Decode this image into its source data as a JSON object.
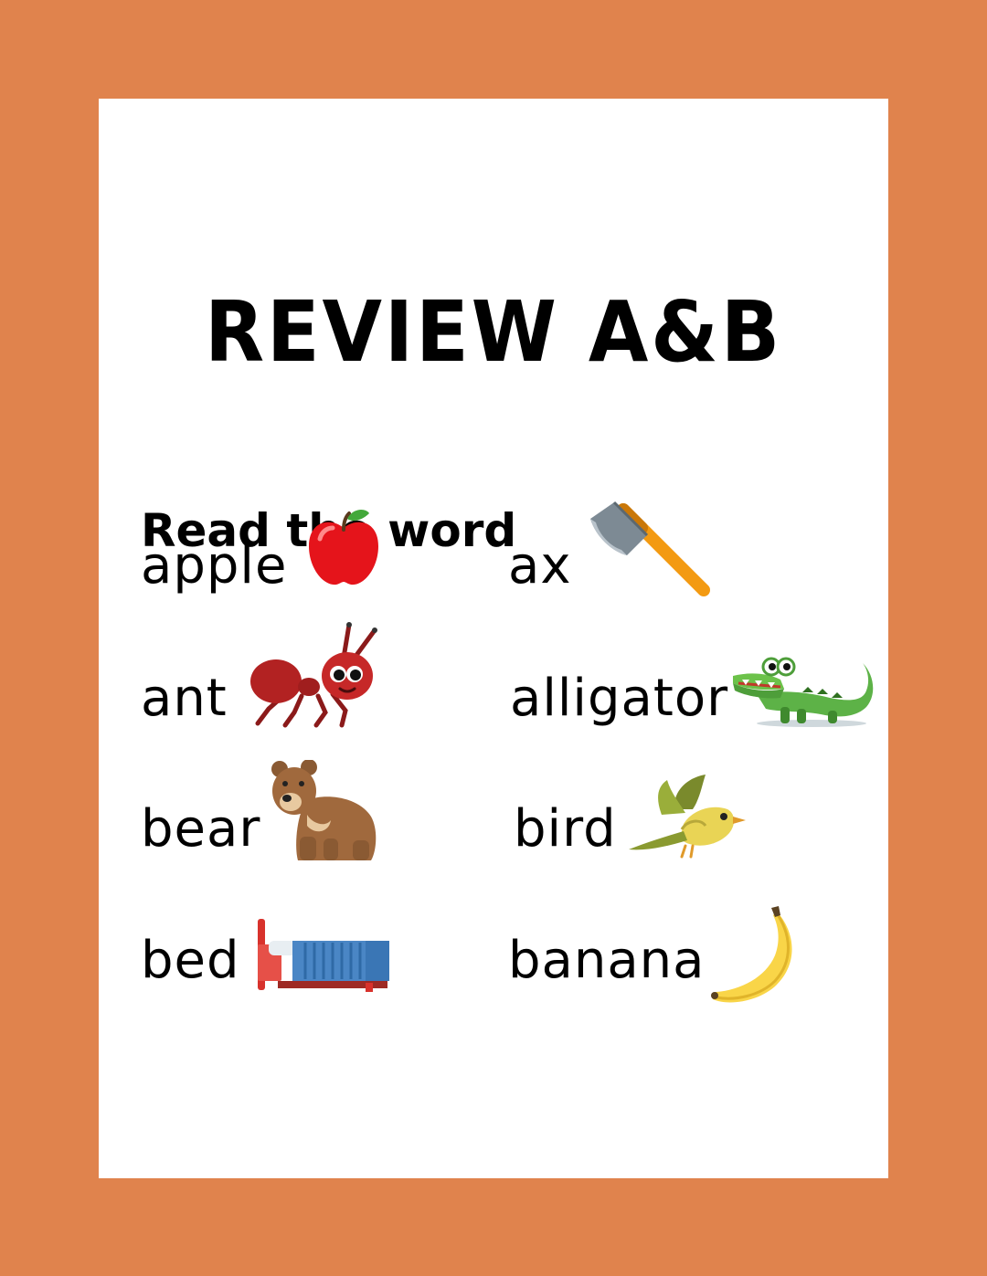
{
  "title": "REVIEW A&B",
  "instruction": "Read the word",
  "words": {
    "apple": "apple",
    "ax": "ax",
    "ant": "ant",
    "alligator": "alligator",
    "bear": "bear",
    "bird": "bird",
    "bed": "bed",
    "banana": "banana"
  },
  "icons": [
    "apple-icon",
    "ax-icon",
    "ant-icon",
    "alligator-icon",
    "bear-icon",
    "bird-icon",
    "bed-icon",
    "banana-icon"
  ],
  "colors": {
    "frame": "#E0834D",
    "paper": "#FFFFFF",
    "text": "#000000"
  }
}
